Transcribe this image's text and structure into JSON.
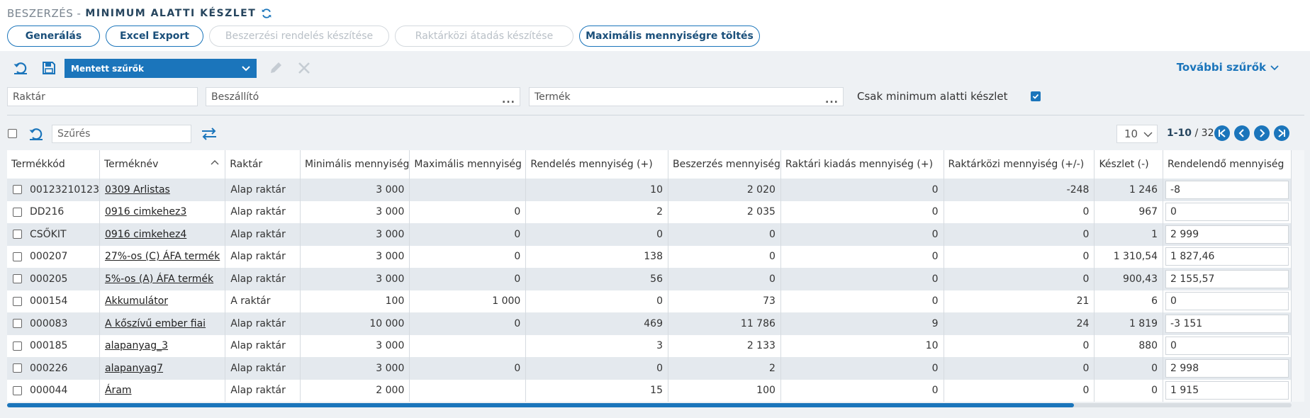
{
  "header": {
    "crumb": "BESZERZÉS -",
    "title": "MINIMUM ALATTI KÉSZLET"
  },
  "actions": [
    {
      "label": "Generálás",
      "enabled": true
    },
    {
      "label": "Excel Export",
      "enabled": true
    },
    {
      "label": "Beszerzési rendelés készítése",
      "enabled": false
    },
    {
      "label": "Raktárközi átadás készítése",
      "enabled": false
    },
    {
      "label": "Maximális mennyiségre töltés",
      "enabled": true
    }
  ],
  "filters": {
    "saved_filter": "Mentett szűrők",
    "more_filters": "További szűrők",
    "warehouse_placeholder": "Raktár",
    "supplier_placeholder": "Beszállító",
    "product_placeholder": "Termék",
    "only_below_min_label": "Csak minimum alatti készlet",
    "only_below_min_checked": true
  },
  "grid_toolbar": {
    "search_placeholder": "Szűrés",
    "page_size": "10",
    "page_range": "1-10",
    "page_total": "/ 32"
  },
  "table": {
    "columns": [
      "Termékkód",
      "Terméknév",
      "Raktár",
      "Minimális mennyiség",
      "Maximális mennyiség",
      "Rendelés mennyiség (+)",
      "Beszerzés mennyiség",
      "Raktári kiadás mennyiség (+)",
      "Raktárközi mennyiség (+/-)",
      "Készlet (-)",
      "Rendelendő mennyiség"
    ],
    "rows": [
      [
        "00123210123",
        "0309 Arlistas",
        "Alap raktár",
        "3 000",
        "",
        "10",
        "2 020",
        "0",
        "-248",
        "1 246",
        "-8"
      ],
      [
        "DD216",
        "0916 cimkehez3",
        "Alap raktár",
        "3 000",
        "0",
        "2",
        "2 035",
        "0",
        "0",
        "967",
        "0"
      ],
      [
        "CSŐKIT",
        "0916 cimkehez4",
        "Alap raktár",
        "3 000",
        "0",
        "0",
        "0",
        "0",
        "0",
        "1",
        "2 999"
      ],
      [
        "000207",
        "27%-os (C) ÁFA termék",
        "Alap raktár",
        "3 000",
        "0",
        "138",
        "0",
        "0",
        "0",
        "1 310,54",
        "1 827,46"
      ],
      [
        "000205",
        "5%-os (A) ÁFA termék",
        "Alap raktár",
        "3 000",
        "0",
        "56",
        "0",
        "0",
        "0",
        "900,43",
        "2 155,57"
      ],
      [
        "000154",
        "Akkumulátor",
        "A raktár",
        "100",
        "1 000",
        "0",
        "73",
        "0",
        "21",
        "6",
        "0"
      ],
      [
        "000083",
        "A kőszívű ember fiai",
        "Alap raktár",
        "10 000",
        "0",
        "469",
        "11 786",
        "9",
        "24",
        "1 819",
        "-3 151"
      ],
      [
        "000185",
        "alapanyag_3",
        "Alap raktár",
        "3 000",
        "",
        "3",
        "2 133",
        "10",
        "0",
        "880",
        "0"
      ],
      [
        "000226",
        "alapanyag7",
        "Alap raktár",
        "3 000",
        "0",
        "0",
        "2",
        "0",
        "0",
        "0",
        "2 998"
      ],
      [
        "000044",
        "Áram",
        "Alap raktár",
        "2 000",
        "",
        "15",
        "100",
        "0",
        "0",
        "0",
        "1 915"
      ]
    ]
  },
  "colors": {
    "accent": "#1b75bb",
    "title": "#26455e",
    "row_alt": "#e4e9ee"
  }
}
